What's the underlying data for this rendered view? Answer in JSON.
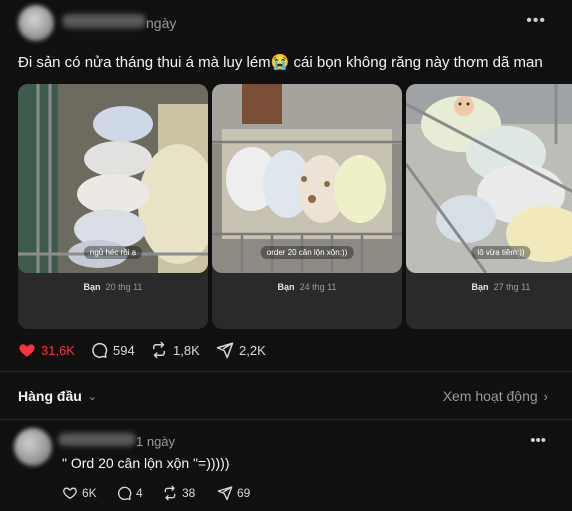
{
  "post": {
    "time": "ngày",
    "caption": "Đi sản có nửa tháng thui á mà luy lém😭 cái bọn không răng này thơm dã man",
    "cards": [
      {
        "sticker": "ngủ héc rồi ạ",
        "author": "Bạn",
        "date": "20 thg 11"
      },
      {
        "sticker": "order 20 cân lộn xộn:))",
        "author": "Bạn",
        "date": "24 thg 11"
      },
      {
        "sticker": "lô vừa tiêm:))",
        "author": "Bạn",
        "date": "27 thg 11"
      }
    ],
    "likes": "31,6K",
    "comments": "594",
    "reposts": "1,8K",
    "shares": "2,2K",
    "like_color": "#ff3040"
  },
  "thread": {
    "sort_label": "Hàng đầu",
    "activity_label": "Xem hoạt động"
  },
  "reply": {
    "time": "1 ngày",
    "text": "\" Ord 20 cân lộn xộn \"=)))))",
    "likes": "6K",
    "comments": "4",
    "reposts": "38",
    "shares": "69"
  },
  "icons": [
    "heart-icon",
    "comment-icon",
    "repost-icon",
    "share-icon",
    "more-icon",
    "chevron-down-icon",
    "chevron-right-icon"
  ]
}
